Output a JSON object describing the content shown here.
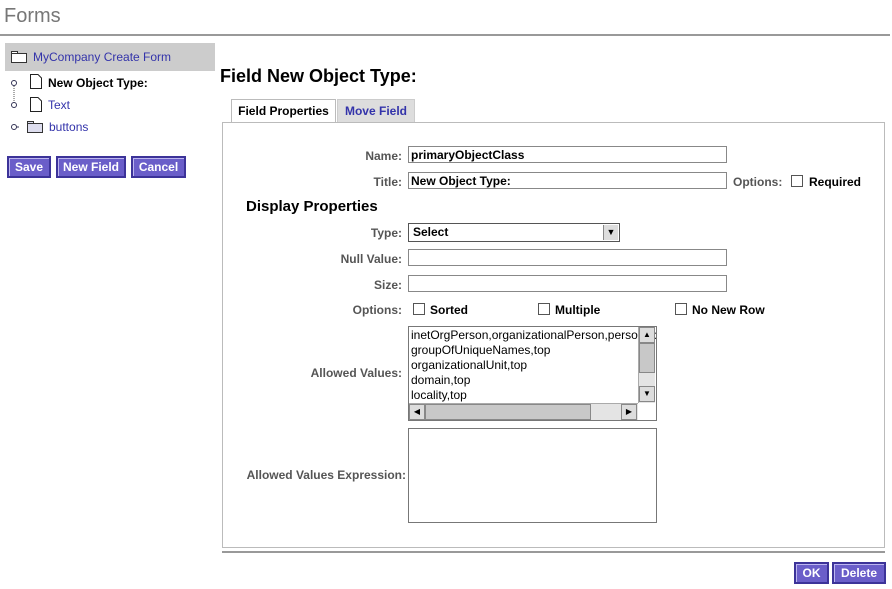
{
  "page": {
    "title": "Forms"
  },
  "tree": {
    "root": "MyCompany Create Form",
    "items": [
      {
        "label": "New Object Type:",
        "icon": "page-icon",
        "selected": true
      },
      {
        "label": "Text",
        "icon": "page-icon",
        "selected": false
      },
      {
        "label": "buttons",
        "icon": "folder-icon",
        "selected": false
      }
    ]
  },
  "left_buttons": {
    "save": "Save",
    "new_field": "New Field",
    "cancel": "Cancel"
  },
  "heading": "Field New Object Type:",
  "tabs": [
    {
      "label": "Field Properties",
      "active": true
    },
    {
      "label": "Move Field",
      "active": false
    }
  ],
  "form": {
    "name_label": "Name:",
    "name_value": "primaryObjectClass",
    "title_label": "Title:",
    "title_value": "New Object Type:",
    "options_label": "Options:",
    "required_label": "Required",
    "display_properties": "Display Properties",
    "type_label": "Type:",
    "type_value": "Select",
    "null_label": "Null Value:",
    "null_value": "",
    "size_label": "Size:",
    "size_value": "",
    "options2_label": "Options:",
    "sorted_label": "Sorted",
    "multiple_label": "Multiple",
    "no_new_row_label": "No New Row",
    "allowed_label": "Allowed Values:",
    "allowed_values": [
      "inetOrgPerson,organizationalPerson,person,top",
      "groupOfUniqueNames,top",
      "organizationalUnit,top",
      "domain,top",
      "locality,top"
    ],
    "expression_label": "Allowed Values Expression:",
    "expression_value": ""
  },
  "footer_buttons": {
    "ok": "OK",
    "delete": "Delete"
  },
  "colors": {
    "button": "#6a5ec9",
    "link": "#3333aa",
    "tree_header": "#cccccc"
  }
}
